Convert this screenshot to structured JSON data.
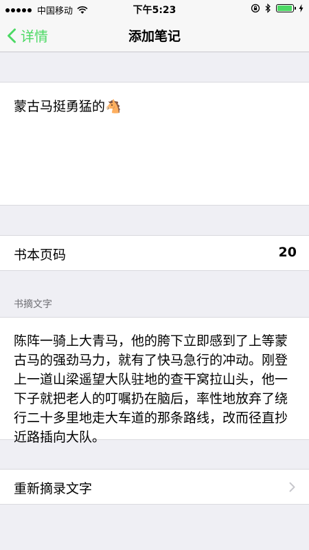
{
  "status_bar": {
    "carrier": "中国移动",
    "time": "下午5:23"
  },
  "nav": {
    "back_label": "详情",
    "title": "添加笔记"
  },
  "note": {
    "text": "蒙古马挺勇猛的🐴"
  },
  "page": {
    "label": "书本页码",
    "value": "20"
  },
  "excerpt": {
    "header": "书摘文字",
    "text": "陈阵一骑上大青马，他的胯下立即感到了上等蒙古马的强劲马力，就有了快马急行的冲动。刚登上一道山梁遥望大队驻地的查干窝拉山头，他一下子就把老人的叮嘱扔在脑后，率性地放弃了绕行二十多里地走大车道的那条路线，改而径直抄近路插向大队。"
  },
  "rerecord": {
    "label": "重新摘录文字"
  },
  "colors": {
    "accent": "#4cd964",
    "background": "#efeff4"
  }
}
